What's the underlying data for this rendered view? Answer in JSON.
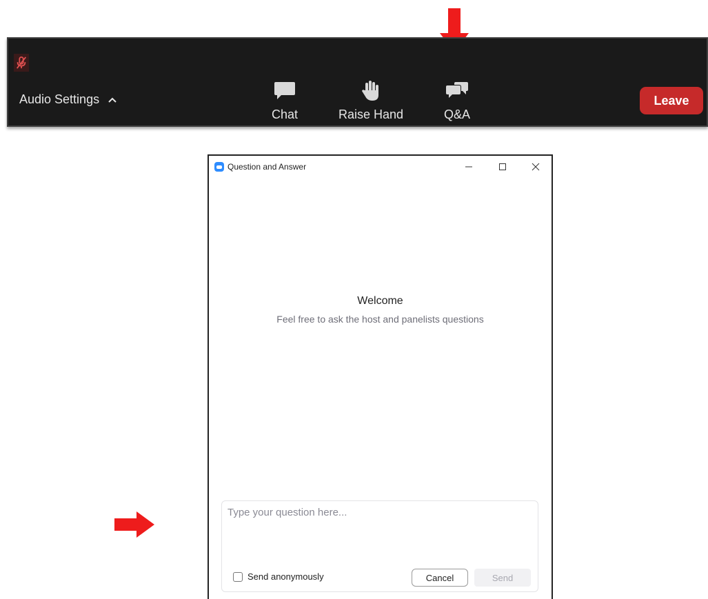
{
  "toolbar": {
    "audio_settings_label": "Audio Settings",
    "chat_label": "Chat",
    "raise_hand_label": "Raise Hand",
    "qa_label": "Q&A",
    "leave_label": "Leave"
  },
  "qa_window": {
    "title": "Question and Answer",
    "welcome_title": "Welcome",
    "welcome_subtitle": "Feel free to ask the host and panelists questions",
    "input_placeholder": "Type your question here...",
    "anonymous_label": "Send anonymously",
    "anonymous_checked": false,
    "cancel_label": "Cancel",
    "send_label": "Send"
  },
  "icons": {
    "mute": "muted-microphone-icon",
    "chat": "chat-bubble-icon",
    "raise_hand": "hand-icon",
    "qa": "qa-bubbles-icon"
  },
  "colors": {
    "toolbar_bg": "#1a1a1a",
    "leave_button": "#c62a2a",
    "arrow": "#ee1c1c",
    "app_icon": "#2d8cff"
  }
}
